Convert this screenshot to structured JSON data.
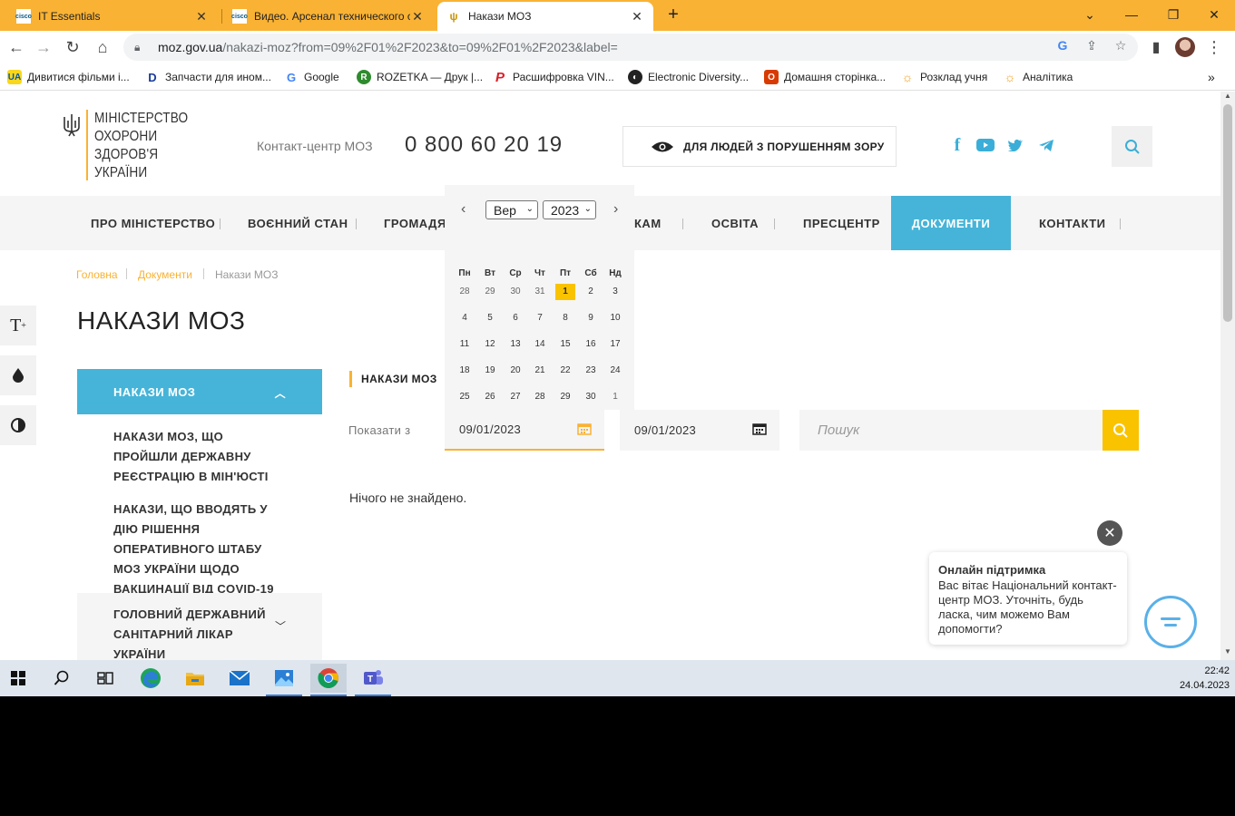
{
  "browser": {
    "tabs": [
      {
        "title": "IT Essentials",
        "favicon": "cisco"
      },
      {
        "title": "Видео. Арсенал технического специалиста",
        "favicon": "cisco"
      },
      {
        "title": "Накази МОЗ",
        "favicon": "trident"
      }
    ],
    "url": {
      "host": "moz.gov.ua",
      "path": "/nakazi-moz?from=09%2F01%2F2023&to=09%2F01%2F2023&label="
    },
    "bookmarks": [
      {
        "label": "Дивитися фільми і...",
        "icon": "UA"
      },
      {
        "label": "Запчасти для ином...",
        "icon": "D"
      },
      {
        "label": "Google",
        "icon": "G"
      },
      {
        "label": "ROZETKA — Друк |...",
        "icon": "R"
      },
      {
        "label": "Расшифровка VIN...",
        "icon": "P"
      },
      {
        "label": "Electronic Diversity...",
        "icon": "E"
      },
      {
        "label": "Домашня сторінка...",
        "icon": "O"
      },
      {
        "label": "Розклад учня",
        "icon": "S"
      },
      {
        "label": "Аналітика",
        "icon": "S"
      }
    ]
  },
  "site": {
    "logo_lines": [
      "МІНІСТЕРСТВО",
      "ОХОРОНИ",
      "ЗДОРОВ'Я",
      "УКРАЇНИ"
    ],
    "contact_label": "Контакт-центр МОЗ",
    "contact_phone": "0 800 60 20 19",
    "vision_label": "ДЛЯ ЛЮДЕЙ З ПОРУШЕННЯМ ЗОРУ",
    "accent": "#f9b233",
    "nav_active_color": "#46b4d8",
    "nav": [
      "ПРО МІНІСТЕРСТВО",
      "ВОЄННИЙ СТАН",
      "ГРОМАДЯН",
      "КАМ",
      "ОСВІТА",
      "ПРЕСЦЕНТР",
      "ДОКУМЕНТИ",
      "КОНТАКТИ"
    ],
    "breadcrumb": [
      "Головна",
      "Документи",
      "Накази МОЗ"
    ],
    "page_title": "НАКАЗИ МОЗ",
    "sidebar": {
      "active": "НАКАЗИ МОЗ",
      "subitems": [
        "НАКАЗИ МОЗ, ЩО ПРОЙШЛИ ДЕРЖАВНУ РЕЄСТРАЦІЮ В МІН'ЮСТІ",
        "НАКАЗИ, ЩО ВВОДЯТЬ У ДІЮ РІШЕННЯ ОПЕРАТИВНОГО ШТАБУ МОЗ УКРАЇНИ ЩОДО ВАКЦИНАЦІЇ ВІД COVID-19"
      ],
      "group": "ГОЛОВНИЙ ДЕРЖАВНИЙ САНІТАРНИЙ ЛІКАР УКРАЇНИ"
    },
    "filter": {
      "section_label": "НАКАЗИ МОЗ",
      "show_from": "Показати з",
      "date_from": "09/01/2023",
      "date_to": "09/01/2023",
      "search_placeholder": "Пошук",
      "empty_result": "Нічого не знайдено."
    },
    "datepicker": {
      "month": "Вер",
      "year": "2023",
      "weekdays": [
        "Пн",
        "Вт",
        "Ср",
        "Чт",
        "Пт",
        "Сб",
        "Нд"
      ],
      "weeks": [
        [
          "28",
          "29",
          "30",
          "31",
          "1",
          "2",
          "3"
        ],
        [
          "4",
          "5",
          "6",
          "7",
          "8",
          "9",
          "10"
        ],
        [
          "11",
          "12",
          "13",
          "14",
          "15",
          "16",
          "17"
        ],
        [
          "18",
          "19",
          "20",
          "21",
          "22",
          "23",
          "24"
        ],
        [
          "25",
          "26",
          "27",
          "28",
          "29",
          "30",
          "1"
        ]
      ],
      "selected": "1"
    },
    "chat": {
      "title": "Онлайн підтримка",
      "message": "Вас вітає Національний контакт-центр МОЗ. Уточніть, будь ласка, чим можемо Вам допомогти?"
    }
  },
  "taskbar": {
    "time": "22:42",
    "date": "24.04.2023"
  }
}
